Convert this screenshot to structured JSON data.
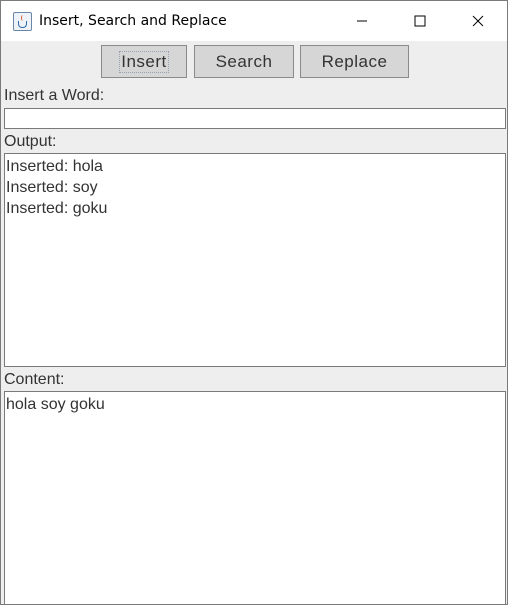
{
  "window": {
    "title": "Insert, Search and Replace",
    "app_icon": "java-cup-icon",
    "controls": [
      "minimize-icon",
      "maximize-icon",
      "close-icon"
    ]
  },
  "toolbar": {
    "insert_label": "Insert",
    "search_label": "Search",
    "replace_label": "Replace"
  },
  "insert_word": {
    "label": "Insert a Word:",
    "value": ""
  },
  "output": {
    "label": "Output:",
    "lines": [
      "Inserted: hola",
      "Inserted: soy",
      "Inserted: goku"
    ]
  },
  "content": {
    "label": "Content:",
    "lines": [
      "hola soy goku"
    ]
  }
}
